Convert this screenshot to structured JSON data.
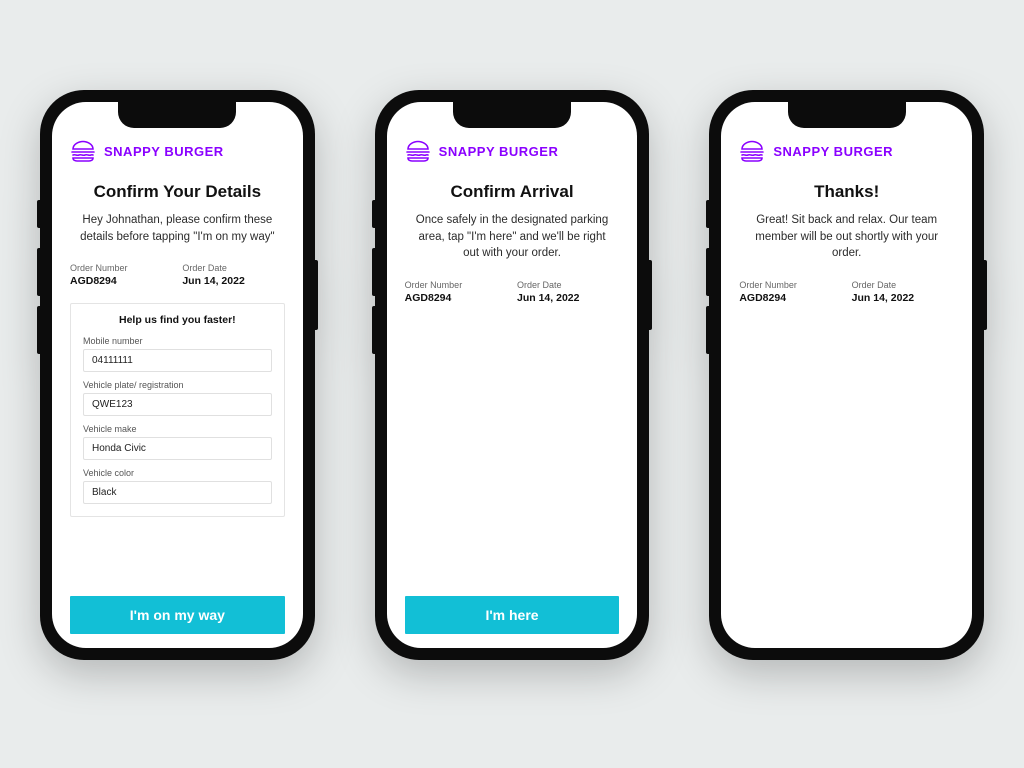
{
  "brand": {
    "name": "SNAPPY BURGER"
  },
  "order": {
    "number_label": "Order Number",
    "number_value": "AGD8294",
    "date_label": "Order Date",
    "date_value": "Jun 14,  2022"
  },
  "screen1": {
    "title": "Confirm Your Details",
    "subtitle": "Hey Johnathan, please confirm these details before tapping \"I'm on my way\"",
    "form_title": "Help us find you faster!",
    "fields": {
      "mobile": {
        "label": "Mobile number",
        "value": "04111111"
      },
      "plate": {
        "label": "Vehicle plate/ registration",
        "value": "QWE123"
      },
      "make": {
        "label": "Vehicle make",
        "value": "Honda Civic"
      },
      "color": {
        "label": "Vehicle color",
        "value": "Black"
      }
    },
    "cta": "I'm on my way"
  },
  "screen2": {
    "title": "Confirm Arrival",
    "subtitle": "Once safely in the designated parking area, tap \"I'm here\" and we'll be right out with your order.",
    "cta": "I'm here"
  },
  "screen3": {
    "title": "Thanks!",
    "subtitle": "Great! Sit back and relax. Our team member will be out shortly with your order."
  }
}
